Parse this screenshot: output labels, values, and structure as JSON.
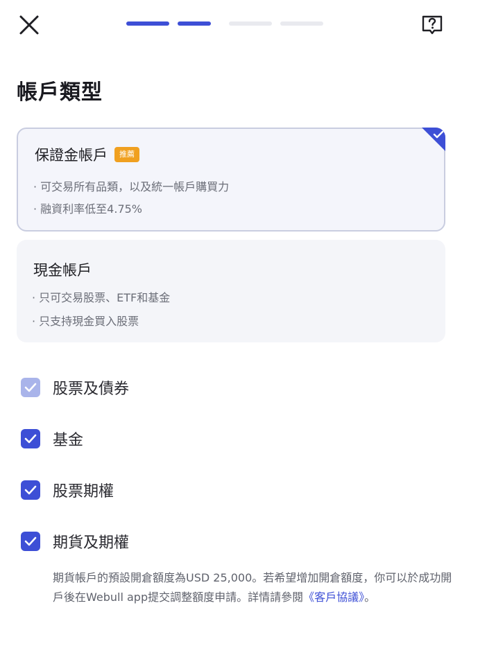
{
  "header": {
    "close_icon": "close-icon",
    "help_icon": "help-icon",
    "progress": {
      "steps_total": 4,
      "steps_completed": 2
    }
  },
  "page_title": "帳戶類型",
  "account_types": [
    {
      "title": "保證金帳戶",
      "badge": "推薦",
      "selected": true,
      "desc": [
        "· 可交易所有品類，以及統一帳戶購買力",
        "· 融資利率低至4.75%"
      ]
    },
    {
      "title": "現金帳戶",
      "selected": false,
      "desc": [
        "· 只可交易股票、ETF和基金",
        "· 只支持現金買入股票"
      ]
    }
  ],
  "products": [
    {
      "label": "股票及債券",
      "checked": true,
      "disabled": true
    },
    {
      "label": "基金",
      "checked": true,
      "disabled": false
    },
    {
      "label": "股票期權",
      "checked": true,
      "disabled": false
    },
    {
      "label": "期貨及期權",
      "checked": true,
      "disabled": false
    }
  ],
  "note": {
    "text": "期貨帳戶的預設開倉額度為USD 25,000。若希望增加開倉額度，你可以於成功開戶後在Webull app提交調整額度申請。詳情請參閱",
    "link": "《客戶協議》",
    "suffix": "。"
  },
  "colors": {
    "accent": "#3d4fd6",
    "accent_disabled": "#a9b4ea",
    "progress_inactive": "#e9eaef",
    "badge": "#f0a020"
  }
}
